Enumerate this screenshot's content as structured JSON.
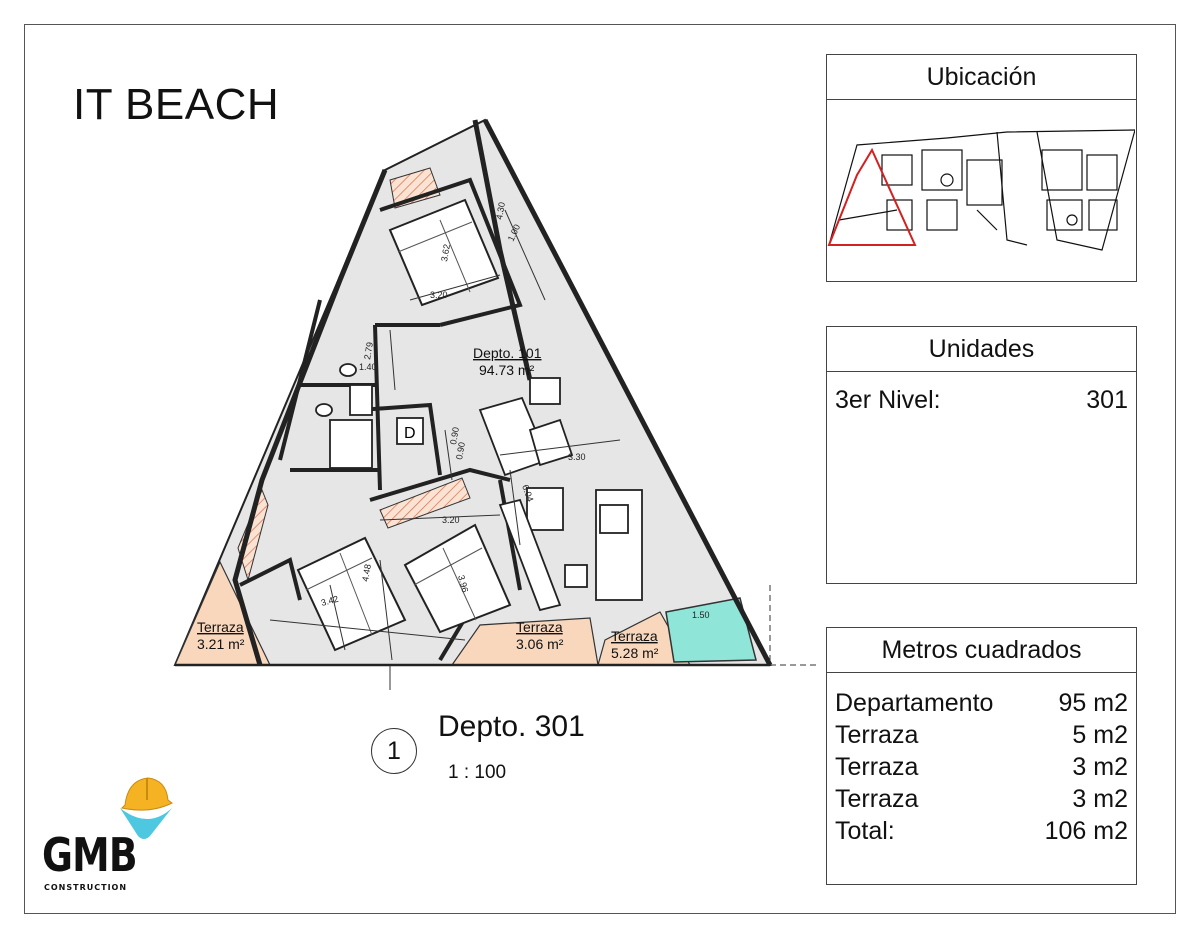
{
  "project_title": "IT BEACH",
  "plan": {
    "unit_label": "Depto. 101",
    "unit_area": "94.73 m²",
    "door_symbol": "D",
    "terraces": [
      {
        "label": "Terraza",
        "area": "3.21 m²"
      },
      {
        "label": "Terraza",
        "area": "3.06 m²"
      },
      {
        "label": "Terraza",
        "area": "5.28 m²"
      }
    ],
    "dimensions": [
      "4.30",
      "1.00",
      "3.62",
      "3.20",
      "2.79",
      "1.40",
      "0.90",
      "0.90",
      "3.30",
      "6.04",
      "3.20",
      "4.48",
      "3.42",
      "3.96",
      "1.50"
    ]
  },
  "view": {
    "number": "1",
    "title": "Depto. 301",
    "scale": "1 : 100"
  },
  "location_panel": {
    "title": "Ubicación"
  },
  "units_panel": {
    "title": "Unidades",
    "level_label": "3er Nivel:",
    "level_value": "301"
  },
  "area_panel": {
    "title": "Metros cuadrados",
    "rows": [
      {
        "label": "Departamento",
        "value": "95 m2"
      },
      {
        "label": "Terraza",
        "value": "5 m2"
      },
      {
        "label": "Terraza",
        "value": "3 m2"
      },
      {
        "label": "Terraza",
        "value": "3 m2"
      },
      {
        "label": "Total:",
        "value": "106 m2"
      }
    ]
  },
  "logo": {
    "name": "GMB",
    "subtitle": "CONSTRUCTION"
  },
  "colors": {
    "floor": "#e6e6e6",
    "terrace": "#f8d7bd",
    "pool": "#8fe6d8",
    "hatch": "#d86a4a",
    "highlight": "#d32020",
    "helmet": "#f5b324",
    "logo_drop": "#4ec7e0"
  }
}
